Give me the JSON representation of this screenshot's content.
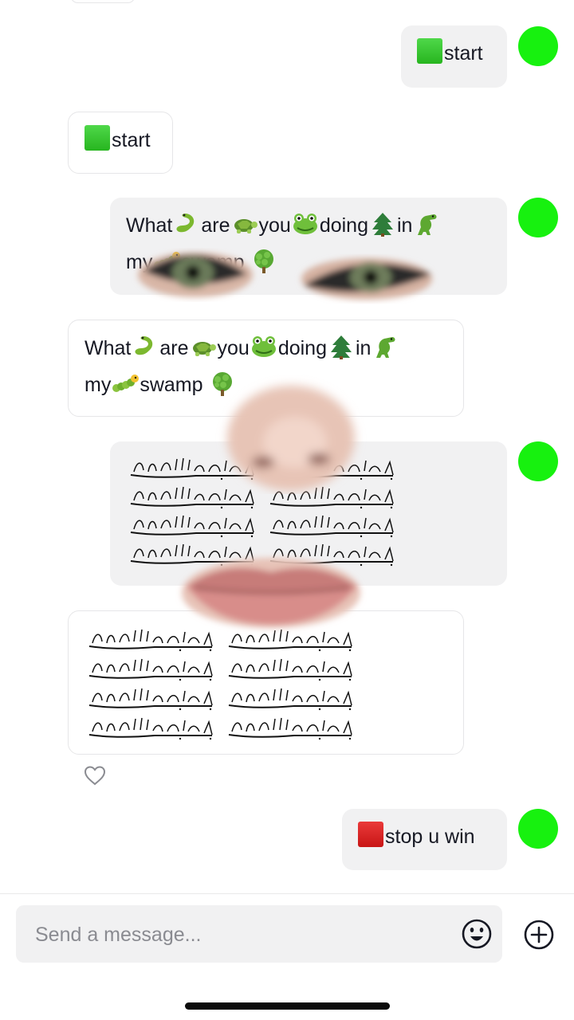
{
  "colors": {
    "avatar": "#17f10f",
    "bubble_outgoing": "#f1f1f2",
    "bubble_incoming": "#ffffff",
    "text": "#161823",
    "placeholder": "#8a8b91"
  },
  "messages": [
    {
      "side": "outgoing",
      "text": "start",
      "icon": "green-square"
    },
    {
      "side": "incoming",
      "text": "start",
      "icon": "green-square"
    },
    {
      "side": "outgoing",
      "words": [
        "What",
        "are",
        "you",
        "doing",
        "in",
        "my",
        "swamp"
      ],
      "emojis": [
        "snake",
        "turtle",
        "frog",
        "evergreen-tree",
        "t-rex",
        "caterpillar",
        "green-bush"
      ]
    },
    {
      "side": "incoming",
      "words": [
        "What",
        "are",
        "you",
        "doing",
        "in",
        "my",
        "swamp"
      ],
      "emojis": [
        "snake",
        "turtle",
        "frog",
        "evergreen-tree",
        "t-rex",
        "caterpillar",
        "green-bush"
      ]
    },
    {
      "side": "outgoing",
      "content": "arabic-calligraphy-grid"
    },
    {
      "side": "incoming",
      "content": "arabic-calligraphy-grid"
    },
    {
      "side": "outgoing",
      "text": "stop u win",
      "icon": "red-square"
    }
  ],
  "icons": [
    "heart-icon",
    "emoji-icon",
    "plus-icon"
  ],
  "composer": {
    "placeholder": "Send a message..."
  }
}
